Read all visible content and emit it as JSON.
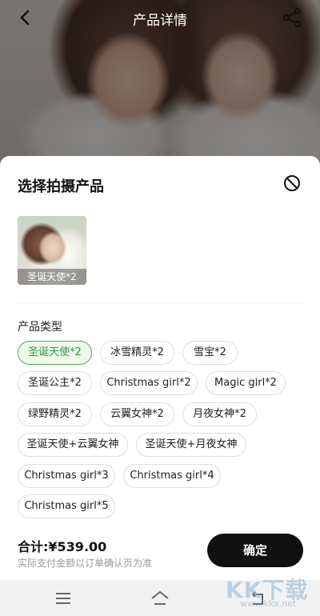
{
  "header": {
    "title": "产品详情"
  },
  "sheet": {
    "title": "选择拍摄产品",
    "selected_product": {
      "label": "圣诞天使*2"
    },
    "section_label": "产品类型",
    "chips": [
      {
        "label": "圣诞天使*2",
        "selected": true
      },
      {
        "label": "冰雪精灵*2",
        "selected": false
      },
      {
        "label": "雪宝*2",
        "selected": false
      },
      {
        "label": "圣诞公主*2",
        "selected": false
      },
      {
        "label": "Christmas girl*2",
        "selected": false
      },
      {
        "label": "Magic girl*2",
        "selected": false
      },
      {
        "label": "绿野精灵*2",
        "selected": false
      },
      {
        "label": "云翼女神*2",
        "selected": false
      },
      {
        "label": "月夜女神*2",
        "selected": false
      },
      {
        "label": "圣诞天使+云翼女神",
        "selected": false
      },
      {
        "label": "圣诞天使+月夜女神",
        "selected": false
      },
      {
        "label": "Christmas girl*3",
        "selected": false
      },
      {
        "label": "Christmas girl*4",
        "selected": false
      },
      {
        "label": "Christmas girl*5",
        "selected": false
      }
    ],
    "total_label": "合计:",
    "total_value": "¥539.00",
    "note": "实际支付金额以订单确认页为准",
    "confirm_label": "确定"
  },
  "watermark": {
    "text": "KK下载",
    "url": "www.kkx.net"
  },
  "colors": {
    "selected_border": "#4caf50",
    "selected_bg": "#eef9ea",
    "confirm_bg": "#111111"
  }
}
